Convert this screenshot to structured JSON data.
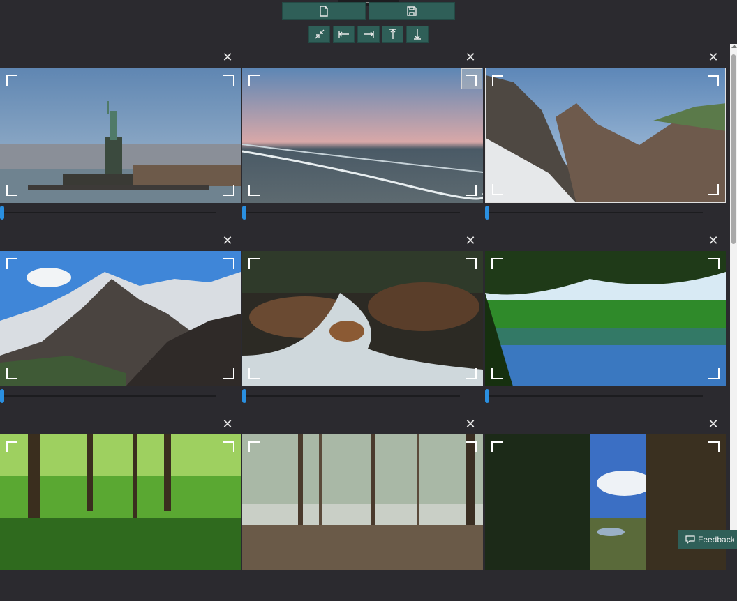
{
  "toolbar": {
    "top": [
      {
        "name": "new-file-button",
        "icon": "new-file-icon"
      },
      {
        "name": "save-button",
        "icon": "save-icon"
      }
    ],
    "bottom": [
      {
        "name": "fit-shrink-button",
        "icon": "shrink-arrows-icon"
      },
      {
        "name": "align-left-button",
        "icon": "arrow-left-bar-icon"
      },
      {
        "name": "align-right-button",
        "icon": "arrow-right-bar-icon"
      },
      {
        "name": "align-top-button",
        "icon": "arrow-top-bar-icon"
      },
      {
        "name": "align-bottom-button",
        "icon": "arrow-bottom-bar-icon"
      }
    ]
  },
  "close_glyph": "✕",
  "slider_value": 0,
  "images": [
    {
      "subject": "statue-of-liberty",
      "selected": false
    },
    {
      "subject": "ocean-beach-sunset",
      "selected": false,
      "corner_highlight": true
    },
    {
      "subject": "rocky-cliffs",
      "selected": true
    },
    {
      "subject": "snowy-mountains",
      "selected": false
    },
    {
      "subject": "stream-rocks",
      "selected": false
    },
    {
      "subject": "forest-lake",
      "selected": false
    },
    {
      "subject": "green-forest",
      "selected": false
    },
    {
      "subject": "birch-woods",
      "selected": false
    },
    {
      "subject": "trail-sky",
      "selected": false
    }
  ],
  "feedback": {
    "label": "Feedback",
    "icon": "feedback-icon"
  },
  "colors": {
    "accent": "#2f5f58",
    "slider": "#2a8fe0",
    "background": "#2b2a2f"
  }
}
